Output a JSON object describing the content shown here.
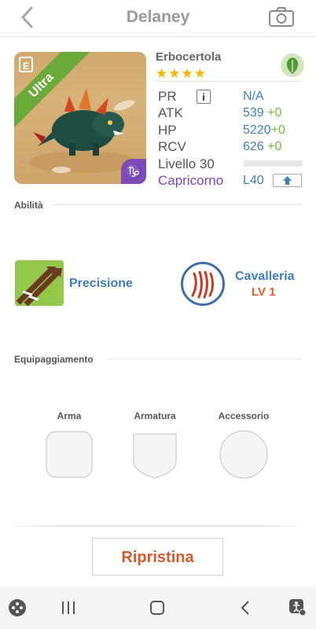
{
  "header": {
    "title": "Delaney"
  },
  "card": {
    "rarity": "Ultra",
    "class_letter": "E",
    "zodiac_symbol": "♑",
    "art_name": "dragon-monster-art"
  },
  "monster": {
    "name": "Erbocertola",
    "stars": "★★★★",
    "element_icon": "leaf-icon",
    "stats": {
      "pr_label": "PR",
      "pr_value": "N/A",
      "atk_label": "ATK",
      "atk_value": "539",
      "atk_bonus": "+0",
      "hp_label": "HP",
      "hp_value": "5220",
      "hp_bonus": "+0",
      "rcv_label": "RCV",
      "rcv_value": "626",
      "rcv_bonus": "+0",
      "level_label": "Livello 30",
      "level_progress": 0
    },
    "zodiac": "Capricorno",
    "limit": "L40"
  },
  "abilities": {
    "title": "Abilità",
    "items": [
      {
        "label": "Precisione",
        "icon": "crossed-swords-icon"
      },
      {
        "label": "Cavalleria",
        "level": "LV 1",
        "icon": "claw-marks-icon"
      }
    ]
  },
  "equipment": {
    "title": "Equipaggiamento",
    "slots": [
      {
        "label": "Arma",
        "icon": "weapon-slot"
      },
      {
        "label": "Armatura",
        "icon": "armor-slot"
      },
      {
        "label": "Accessorio",
        "icon": "accessory-slot"
      }
    ]
  },
  "reset_button": "Ripristina",
  "colors": {
    "accent": "#3f7fbf",
    "bonus": "#6fbb3f",
    "action": "#d85a2b",
    "zodiac": "#7b47b0",
    "rarity": "#6aaa38"
  },
  "navbar": {
    "icons": [
      "game-launcher-icon",
      "recent-apps-icon",
      "home-icon",
      "back-icon",
      "accessibility-icon"
    ]
  }
}
